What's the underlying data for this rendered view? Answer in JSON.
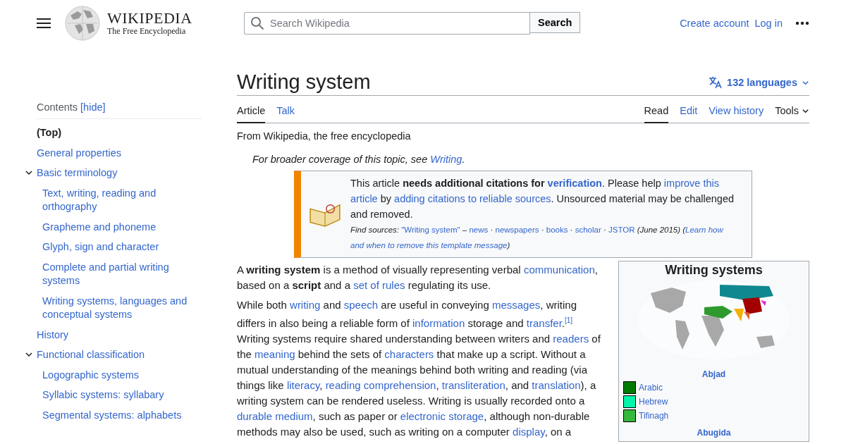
{
  "header": {
    "logo_title": "WIKIPEDIA",
    "logo_tagline": "The Free Encyclopedia",
    "search": {
      "placeholder": "Search Wikipedia",
      "button": "Search"
    },
    "links": [
      "Create account",
      "Log in"
    ]
  },
  "toc": {
    "title": "Contents",
    "hide": "[hide]",
    "items": [
      {
        "label": "(Top)",
        "selected": true
      },
      {
        "label": "General properties",
        "selected": false
      },
      {
        "label": "Basic terminology",
        "selected": false,
        "expanded": true,
        "children": [
          {
            "label": "Text, writing, reading and orthography",
            "selected": false
          },
          {
            "label": "Grapheme and phoneme",
            "selected": false
          },
          {
            "label": "Glyph, sign and character",
            "selected": false
          },
          {
            "label": "Complete and partial writing systems",
            "selected": false
          },
          {
            "label": "Writing systems, languages and conceptual systems",
            "selected": false
          }
        ]
      },
      {
        "label": "History",
        "selected": false
      },
      {
        "label": "Functional classification",
        "selected": false,
        "expanded": true,
        "children": [
          {
            "label": "Logographic systems",
            "selected": false
          },
          {
            "label": "Syllabic systems: syllabary",
            "selected": false
          },
          {
            "label": "Segmental systems: alphabets",
            "selected": false
          }
        ]
      }
    ]
  },
  "article": {
    "title": "Writing system",
    "languages": "132 languages",
    "tabs_left": [
      {
        "label": "Article",
        "selected": true
      },
      {
        "label": "Talk",
        "selected": false
      }
    ],
    "tabs_right": [
      {
        "label": "Read",
        "kind": "tab",
        "selected": true
      },
      {
        "label": "Edit",
        "kind": "tab",
        "selected": false
      },
      {
        "label": "View history",
        "kind": "tab",
        "selected": false
      },
      {
        "label": "Tools",
        "kind": "dropdown"
      }
    ],
    "tagline": "From Wikipedia, the free encyclopedia",
    "hatnote": [
      {
        "kind": "plain",
        "text": "For broader coverage of this topic, see "
      },
      {
        "kind": "link",
        "text": "Writing"
      },
      {
        "kind": "plain",
        "text": "."
      }
    ],
    "notice": {
      "message": [
        {
          "kind": "plain",
          "text": "This article "
        },
        {
          "kind": "bold",
          "text": "needs additional citations for "
        },
        {
          "kind": "boldlink",
          "text": "verification"
        },
        {
          "kind": "plain",
          "text": ". Please help "
        },
        {
          "kind": "link",
          "text": "improve this"
        },
        {
          "kind": "link",
          "text": "article"
        },
        {
          "kind": "plain",
          "text": " by "
        },
        {
          "kind": "link",
          "text": "adding citations to reliable sources"
        },
        {
          "kind": "plain",
          "text": ". Unsourced material may be challenged and removed."
        }
      ],
      "sources": [
        {
          "kind": "italic",
          "text": "Find sources: "
        },
        {
          "kind": "link",
          "text": "\"Writing system\""
        },
        {
          "kind": "plain",
          "text": " – "
        },
        {
          "kind": "link",
          "text": "news"
        },
        {
          "kind": "plain",
          "text": " · "
        },
        {
          "kind": "link",
          "text": "newspapers"
        },
        {
          "kind": "plain",
          "text": " · "
        },
        {
          "kind": "link",
          "text": "books"
        },
        {
          "kind": "plain",
          "text": " · "
        },
        {
          "kind": "link",
          "text": "scholar"
        },
        {
          "kind": "plain",
          "text": " · "
        },
        {
          "kind": "link",
          "text": "JSTOR"
        },
        {
          "kind": "italic",
          "text": " (June 2015) ("
        },
        {
          "kind": "italiclink",
          "text": "Learn how"
        },
        {
          "kind": "italiclink",
          "text": "and when to remove this template message"
        },
        {
          "kind": "italic",
          "text": ")"
        }
      ]
    },
    "paragraphs": [
      [
        {
          "kind": "plain",
          "text": "A "
        },
        {
          "kind": "bold",
          "text": "writing system"
        },
        {
          "kind": "plain",
          "text": " is a method of visually representing verbal "
        },
        {
          "kind": "link",
          "text": "communication"
        },
        {
          "kind": "plain",
          "text": ", based on a "
        },
        {
          "kind": "bold",
          "text": "script"
        },
        {
          "kind": "plain",
          "text": " and a "
        },
        {
          "kind": "link",
          "text": "set of rules"
        },
        {
          "kind": "plain",
          "text": " regulating its use."
        }
      ],
      [
        {
          "kind": "plain",
          "text": "While both "
        },
        {
          "kind": "link",
          "text": "writing"
        },
        {
          "kind": "plain",
          "text": " and "
        },
        {
          "kind": "link",
          "text": "speech"
        },
        {
          "kind": "plain",
          "text": " are useful in conveying "
        },
        {
          "kind": "link",
          "text": "messages"
        },
        {
          "kind": "plain",
          "text": ", writing differs in also being a reliable form of "
        },
        {
          "kind": "link",
          "text": "information"
        },
        {
          "kind": "plain",
          "text": " storage and "
        },
        {
          "kind": "link",
          "text": "transfer"
        },
        {
          "kind": "plain",
          "text": "."
        },
        {
          "kind": "sup",
          "text": "[1]"
        },
        {
          "kind": "plain",
          "text": " Writing systems require shared understanding between writers and "
        },
        {
          "kind": "link",
          "text": "readers"
        },
        {
          "kind": "plain",
          "text": " of the "
        },
        {
          "kind": "link",
          "text": "meaning"
        },
        {
          "kind": "plain",
          "text": " behind the sets of "
        },
        {
          "kind": "link",
          "text": "characters"
        },
        {
          "kind": "plain",
          "text": " that make up a script. Without a mutual understanding of the meanings behind both writing and reading (via things like "
        },
        {
          "kind": "link",
          "text": "literacy"
        },
        {
          "kind": "plain",
          "text": ", "
        },
        {
          "kind": "link",
          "text": "reading comprehension"
        },
        {
          "kind": "plain",
          "text": ", "
        },
        {
          "kind": "link",
          "text": "transliteration"
        },
        {
          "kind": "plain",
          "text": ", and "
        },
        {
          "kind": "link",
          "text": "translation"
        },
        {
          "kind": "plain",
          "text": "), a writing system can be rendered useless. Writing is usually recorded onto a "
        },
        {
          "kind": "link",
          "text": "durable medium"
        },
        {
          "kind": "plain",
          "text": ", such as paper or "
        },
        {
          "kind": "link",
          "text": "electronic storage"
        },
        {
          "kind": "plain",
          "text": ", although non-durable methods may also be used, such as writing on a computer "
        },
        {
          "kind": "link",
          "text": "display"
        },
        {
          "kind": "plain",
          "text": ", on a"
        }
      ]
    ],
    "infobox": {
      "title": "Writing systems",
      "groups": [
        {
          "heading": "Abjad",
          "entries": [
            {
              "label": "Arabic",
              "color": "#007a00"
            },
            {
              "label": "Hebrew",
              "color": "#00f5a8"
            },
            {
              "label": "Tifinagh",
              "color": "#36b83e"
            }
          ]
        },
        {
          "heading": "Abugida"
        }
      ]
    }
  }
}
